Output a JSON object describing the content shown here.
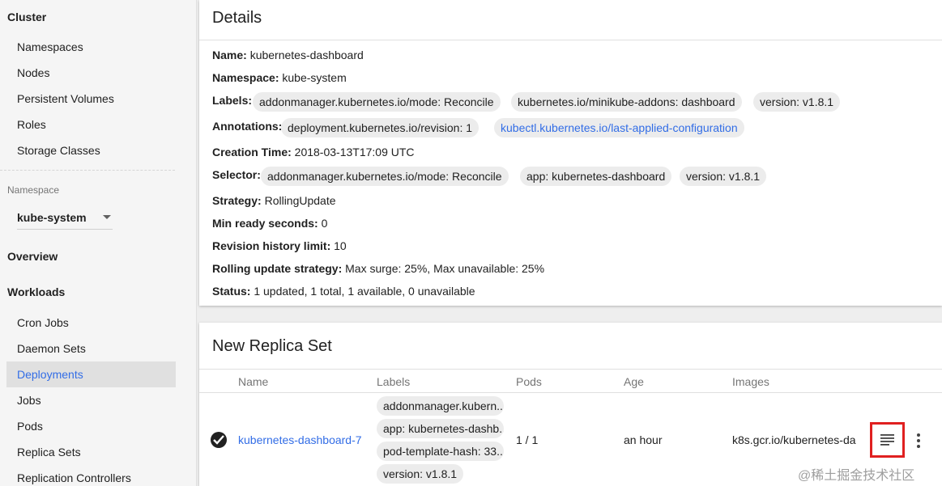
{
  "sidebar": {
    "cluster_header": "Cluster",
    "cluster_items": [
      "Namespaces",
      "Nodes",
      "Persistent Volumes",
      "Roles",
      "Storage Classes"
    ],
    "namespace_label": "Namespace",
    "namespace_value": "kube-system",
    "overview": "Overview",
    "workloads_header": "Workloads",
    "workload_items": [
      "Cron Jobs",
      "Daemon Sets",
      "Deployments",
      "Jobs",
      "Pods",
      "Replica Sets",
      "Replication Controllers"
    ],
    "active_item": "Deployments"
  },
  "details": {
    "title": "Details",
    "name_label": "Name:",
    "name_value": "kubernetes-dashboard",
    "namespace_label": "Namespace:",
    "namespace_value": "kube-system",
    "labels_label": "Labels:",
    "labels": [
      "addonmanager.kubernetes.io/mode: Reconcile",
      "kubernetes.io/minikube-addons: dashboard",
      "version: v1.8.1"
    ],
    "annotations_label": "Annotations:",
    "annotations": [
      "deployment.kubernetes.io/revision:  1",
      "kubectl.kubernetes.io/last-applied-configuration"
    ],
    "creation_label": "Creation Time:",
    "creation_value": "2018-03-13T17:09 UTC",
    "selector_label": "Selector:",
    "selectors": [
      "addonmanager.kubernetes.io/mode: Reconcile",
      "app: kubernetes-dashboard",
      "version: v1.8.1"
    ],
    "strategy_label": "Strategy:",
    "strategy_value": "RollingUpdate",
    "minready_label": "Min ready seconds:",
    "minready_value": "0",
    "revision_label": "Revision history limit:",
    "revision_value": "10",
    "rolling_label": "Rolling update strategy:",
    "rolling_value": "Max surge: 25%, Max unavailable: 25%",
    "status_label": "Status:",
    "status_value": "1 updated, 1 total, 1 available, 0 unavailable"
  },
  "replica": {
    "title": "New Replica Set",
    "columns": [
      "Name",
      "Labels",
      "Pods",
      "Age",
      "Images"
    ],
    "row": {
      "name": "kubernetes-dashboard-7",
      "labels": [
        "addonmanager.kubern...",
        "app: kubernetes-dashb...",
        "pod-template-hash: 33...",
        "version: v1.8.1"
      ],
      "pods": "1 / 1",
      "age": "an hour",
      "images": "k8s.gcr.io/kubernetes-da"
    }
  },
  "watermark": "@稀土掘金技术社区",
  "colors": {
    "accent": "#326de6",
    "highlight_border": "#e02020"
  }
}
